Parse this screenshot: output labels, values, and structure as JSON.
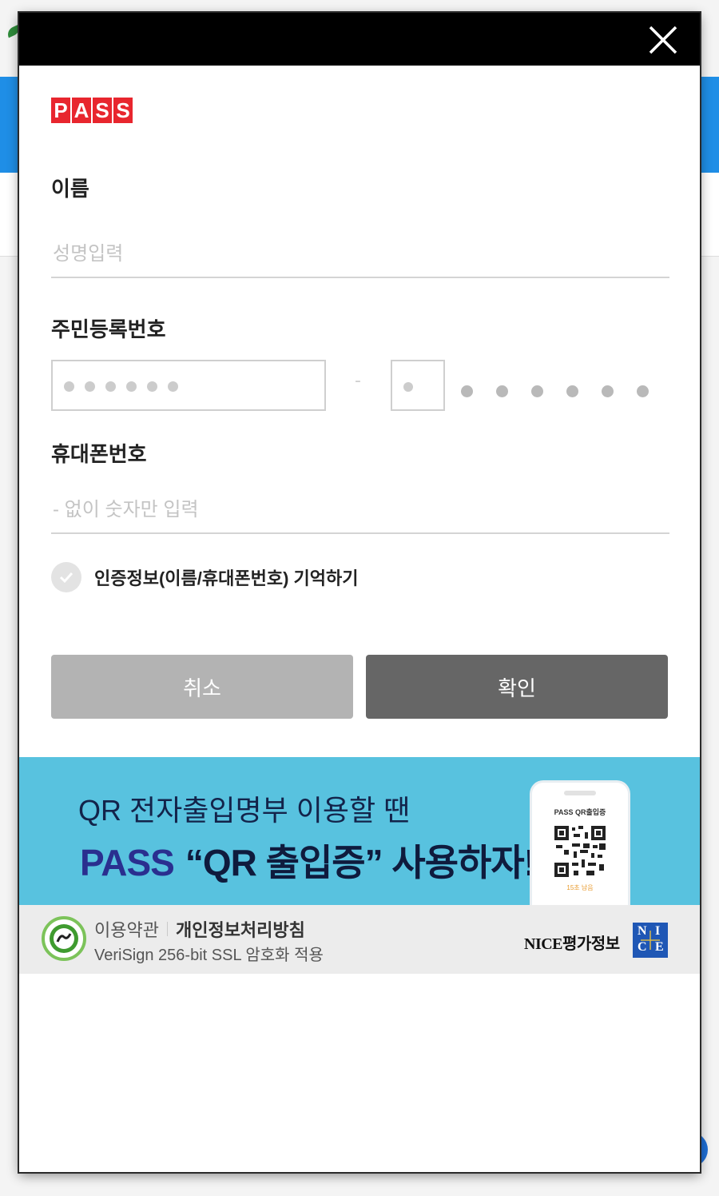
{
  "modal": {
    "close_icon": "close-icon",
    "logo_letters": [
      "P",
      "A",
      "S",
      "S"
    ],
    "name_label": "이름",
    "name_placeholder": "성명입력",
    "rrn_label": "주민등록번호",
    "rrn_separator": "-",
    "phone_label": "휴대폰번호",
    "phone_placeholder": "- 없이 숫자만 입력",
    "remember_label": "인증정보(이름/휴대폰번호) 기억하기",
    "cancel_label": "취소",
    "confirm_label": "확인"
  },
  "banner": {
    "line1": "QR 전자출입명부 이용할 땐",
    "brand": "PASS",
    "line2": "“QR 출입증” 사용하자!",
    "phone_title": "PASS QR출입증",
    "phone_timer": "15초 남음"
  },
  "footer": {
    "terms": "이용약관",
    "privacy": "개인정보처리방침",
    "ssl": "VeriSign 256-bit SSL 암호화 적용",
    "provider": "NICE평가정보",
    "provider_logo_letters": [
      "N",
      "I",
      "C",
      "E"
    ]
  },
  "colors": {
    "pass_red": "#e8262e",
    "banner_bg": "#58c2df",
    "cancel_bg": "#b3b3b3",
    "confirm_bg": "#666666",
    "nice_blue": "#1f57b5"
  }
}
